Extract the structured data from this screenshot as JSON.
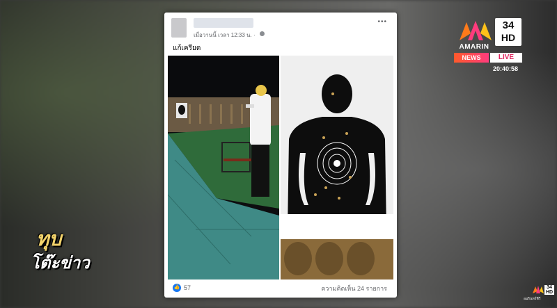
{
  "post": {
    "time_text": "เมื่อวานนี้ เวลา 12:33 น. ·",
    "more_icon": "ellipsis-icon",
    "privacy_icon": "globe-icon",
    "caption": "แก้เครียด",
    "like_icon": "thumbs-up-icon",
    "like_count": "57",
    "comment_count": "ความคิดเห็น 24 รายการ"
  },
  "channel": {
    "brand": "AMARIN",
    "number": "34",
    "hd": "HD",
    "news_label": "NEWS",
    "live_label": "LIVE",
    "clock": "20:40:58",
    "colors": {
      "news_gradient_start": "#ff5a2b",
      "news_gradient_end": "#ff3b7d",
      "live_text": "#e0245e"
    }
  },
  "show": {
    "line1": "ทุบ",
    "line2": "โต๊ะข่าว"
  },
  "corner_bug": {
    "number": "34 HD",
    "subtitle": "อมรินทร์ทีวี"
  },
  "colors": {
    "like_blue": "#1877f2",
    "card_bg": "#ffffff",
    "meta_gray": "#65676b"
  }
}
